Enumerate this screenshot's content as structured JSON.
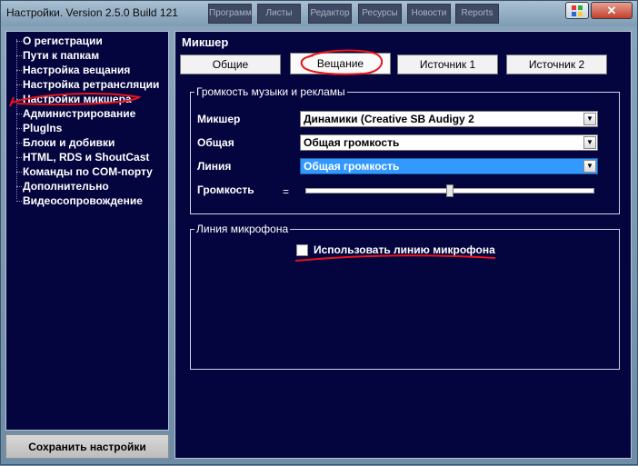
{
  "window": {
    "title": "Настройки. Version 2.5.0 Build 121",
    "ghost_tabs": [
      "Программа",
      "Листы",
      "Редактор",
      "Ресурсы",
      "Новости",
      "Reports"
    ]
  },
  "nav": {
    "items": [
      {
        "label": "О регистрации"
      },
      {
        "label": "Пути к папкам"
      },
      {
        "label": "Настройка вещания"
      },
      {
        "label": "Настройка ретрансляции"
      },
      {
        "label": "Настройки микшера",
        "selected": true
      },
      {
        "label": "Администрирование"
      },
      {
        "label": "PlugIns"
      },
      {
        "label": "Блоки и добивки"
      },
      {
        "label": "HTML, RDS и ShoutCast"
      },
      {
        "label": "Команды по COM-порту"
      },
      {
        "label": "Дополнительно"
      },
      {
        "label": "Видеосопровождение"
      }
    ],
    "save_label": "Сохранить настройки"
  },
  "content": {
    "title": "Микшер",
    "tabs": [
      {
        "label": "Общие"
      },
      {
        "label": "Вещание",
        "active": true
      },
      {
        "label": "Источник 1"
      },
      {
        "label": "Источник 2"
      }
    ],
    "music_group": {
      "legend": "Громкость музыки и рекламы",
      "mixer_label": "Микшер",
      "mixer_value": "Динамики (Creative SB Audigy 2",
      "general_label": "Общая",
      "general_value": "Общая громкость",
      "line_label": "Линия",
      "line_value": "Общая громкость",
      "volume_label": "Громкость",
      "volume_sign": "=",
      "volume_level": 0.5
    },
    "mic_group": {
      "legend": "Линия микрофона",
      "use_mic_label": "Использовать линию микрофона",
      "use_mic_checked": false
    }
  },
  "colors": {
    "panel_bg": "#04043f",
    "highlight": "#3399ff",
    "annotation": "#e8141c"
  },
  "icons": {
    "help": "help-icon",
    "close": "close-icon",
    "dropdown": "chevron-down-icon"
  }
}
